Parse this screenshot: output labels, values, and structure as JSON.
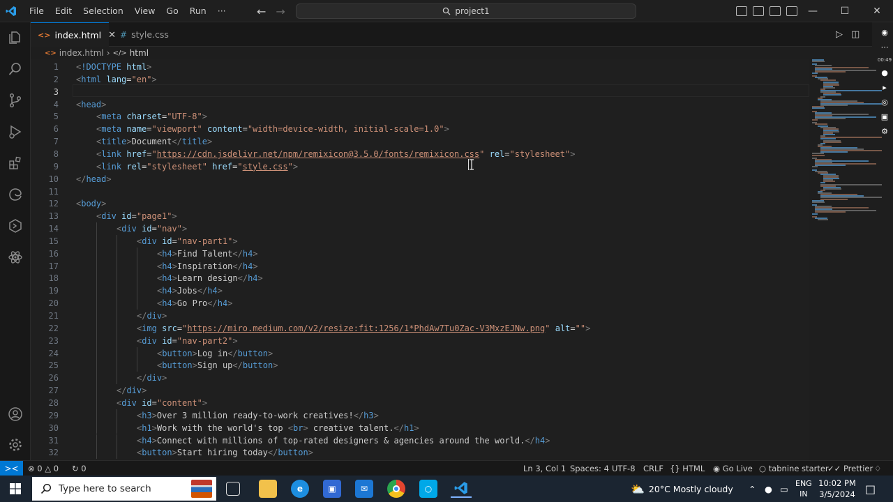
{
  "titlebar": {
    "menu": [
      "File",
      "Edit",
      "Selection",
      "View",
      "Go",
      "Run",
      "···"
    ],
    "search_text": "project1",
    "controls": {
      "minimize": "—",
      "maximize": "☐",
      "close": "✕"
    }
  },
  "activity_bar": {
    "items": [
      "explorer-icon",
      "search-icon",
      "source-control-icon",
      "run-debug-icon",
      "extensions-icon",
      "edge-tools-icon",
      "remote-explorer-icon",
      "ai-assistant-icon"
    ],
    "bottom": [
      "account-icon",
      "settings-gear-icon"
    ]
  },
  "tabs": [
    {
      "label": "index.html",
      "active": true
    },
    {
      "label": "style.css",
      "active": false
    }
  ],
  "breadcrumb": {
    "file": "index.html",
    "sep": "›",
    "symbol": "html"
  },
  "editor": {
    "current_line": 3,
    "lines": [
      {
        "n": "1",
        "indent": 0,
        "parts": [
          [
            "t",
            "<"
          ],
          [
            "tg",
            "!DOCTYPE"
          ],
          [
            "tx",
            " "
          ],
          [
            "at",
            "html"
          ],
          [
            "t",
            ">"
          ]
        ]
      },
      {
        "n": "2",
        "indent": 0,
        "parts": [
          [
            "t",
            "<"
          ],
          [
            "tg",
            "html"
          ],
          [
            "tx",
            " "
          ],
          [
            "at",
            "lang"
          ],
          [
            "tx",
            "="
          ],
          [
            "st",
            "\"en\""
          ],
          [
            "t",
            ">"
          ]
        ]
      },
      {
        "n": "3",
        "indent": 0,
        "parts": []
      },
      {
        "n": "4",
        "indent": 0,
        "parts": [
          [
            "t",
            "<"
          ],
          [
            "tg",
            "head"
          ],
          [
            "t",
            ">"
          ]
        ]
      },
      {
        "n": "5",
        "indent": 1,
        "parts": [
          [
            "t",
            "<"
          ],
          [
            "tg",
            "meta"
          ],
          [
            "tx",
            " "
          ],
          [
            "at",
            "charset"
          ],
          [
            "tx",
            "="
          ],
          [
            "st",
            "\"UTF-8\""
          ],
          [
            "t",
            ">"
          ]
        ]
      },
      {
        "n": "6",
        "indent": 1,
        "parts": [
          [
            "t",
            "<"
          ],
          [
            "tg",
            "meta"
          ],
          [
            "tx",
            " "
          ],
          [
            "at",
            "name"
          ],
          [
            "tx",
            "="
          ],
          [
            "st",
            "\"viewport\""
          ],
          [
            "tx",
            " "
          ],
          [
            "at",
            "content"
          ],
          [
            "tx",
            "="
          ],
          [
            "st",
            "\"width=device-width, initial-scale=1.0\""
          ],
          [
            "t",
            ">"
          ]
        ]
      },
      {
        "n": "7",
        "indent": 1,
        "parts": [
          [
            "t",
            "<"
          ],
          [
            "tg",
            "title"
          ],
          [
            "t",
            ">"
          ],
          [
            "tx",
            "Document"
          ],
          [
            "t",
            "</"
          ],
          [
            "tg",
            "title"
          ],
          [
            "t",
            ">"
          ]
        ]
      },
      {
        "n": "8",
        "indent": 1,
        "parts": [
          [
            "t",
            "<"
          ],
          [
            "tg",
            "link"
          ],
          [
            "tx",
            " "
          ],
          [
            "at",
            "href"
          ],
          [
            "tx",
            "="
          ],
          [
            "st",
            "\""
          ],
          [
            "stu",
            "https://cdn.jsdelivr.net/npm/remixicon@3.5.0/fonts/remixicon.css"
          ],
          [
            "st",
            "\""
          ],
          [
            "tx",
            " "
          ],
          [
            "at",
            "rel"
          ],
          [
            "tx",
            "="
          ],
          [
            "st",
            "\"stylesheet\""
          ],
          [
            "t",
            ">"
          ]
        ]
      },
      {
        "n": "9",
        "indent": 1,
        "parts": [
          [
            "t",
            "<"
          ],
          [
            "tg",
            "link"
          ],
          [
            "tx",
            " "
          ],
          [
            "at",
            "rel"
          ],
          [
            "tx",
            "="
          ],
          [
            "st",
            "\"stylesheet\""
          ],
          [
            "tx",
            " "
          ],
          [
            "at",
            "href"
          ],
          [
            "tx",
            "="
          ],
          [
            "st",
            "\""
          ],
          [
            "stu",
            "style.css"
          ],
          [
            "st",
            "\""
          ],
          [
            "t",
            ">"
          ]
        ]
      },
      {
        "n": "10",
        "indent": 0,
        "parts": [
          [
            "t",
            "</"
          ],
          [
            "tg",
            "head"
          ],
          [
            "t",
            ">"
          ]
        ]
      },
      {
        "n": "11",
        "indent": 0,
        "parts": []
      },
      {
        "n": "12",
        "indent": 0,
        "parts": [
          [
            "t",
            "<"
          ],
          [
            "tg",
            "body"
          ],
          [
            "t",
            ">"
          ]
        ]
      },
      {
        "n": "13",
        "indent": 1,
        "parts": [
          [
            "t",
            "<"
          ],
          [
            "tg",
            "div"
          ],
          [
            "tx",
            " "
          ],
          [
            "at",
            "id"
          ],
          [
            "tx",
            "="
          ],
          [
            "st",
            "\"page1\""
          ],
          [
            "t",
            ">"
          ]
        ]
      },
      {
        "n": "14",
        "indent": 2,
        "parts": [
          [
            "t",
            "<"
          ],
          [
            "tg",
            "div"
          ],
          [
            "tx",
            " "
          ],
          [
            "at",
            "id"
          ],
          [
            "tx",
            "="
          ],
          [
            "st",
            "\"nav\""
          ],
          [
            "t",
            ">"
          ]
        ]
      },
      {
        "n": "15",
        "indent": 3,
        "parts": [
          [
            "t",
            "<"
          ],
          [
            "tg",
            "div"
          ],
          [
            "tx",
            " "
          ],
          [
            "at",
            "id"
          ],
          [
            "tx",
            "="
          ],
          [
            "st",
            "\"nav-part1\""
          ],
          [
            "t",
            ">"
          ]
        ]
      },
      {
        "n": "16",
        "indent": 4,
        "parts": [
          [
            "t",
            "<"
          ],
          [
            "tg",
            "h4"
          ],
          [
            "t",
            ">"
          ],
          [
            "tx",
            "Find Talent"
          ],
          [
            "t",
            "</"
          ],
          [
            "tg",
            "h4"
          ],
          [
            "t",
            ">"
          ]
        ]
      },
      {
        "n": "17",
        "indent": 4,
        "parts": [
          [
            "t",
            "<"
          ],
          [
            "tg",
            "h4"
          ],
          [
            "t",
            ">"
          ],
          [
            "tx",
            "Inspiration"
          ],
          [
            "t",
            "</"
          ],
          [
            "tg",
            "h4"
          ],
          [
            "t",
            ">"
          ]
        ]
      },
      {
        "n": "18",
        "indent": 4,
        "parts": [
          [
            "t",
            "<"
          ],
          [
            "tg",
            "h4"
          ],
          [
            "t",
            ">"
          ],
          [
            "tx",
            "Learn design"
          ],
          [
            "t",
            "</"
          ],
          [
            "tg",
            "h4"
          ],
          [
            "t",
            ">"
          ]
        ]
      },
      {
        "n": "19",
        "indent": 4,
        "parts": [
          [
            "t",
            "<"
          ],
          [
            "tg",
            "h4"
          ],
          [
            "t",
            ">"
          ],
          [
            "tx",
            "Jobs"
          ],
          [
            "t",
            "</"
          ],
          [
            "tg",
            "h4"
          ],
          [
            "t",
            ">"
          ]
        ]
      },
      {
        "n": "20",
        "indent": 4,
        "parts": [
          [
            "t",
            "<"
          ],
          [
            "tg",
            "h4"
          ],
          [
            "t",
            ">"
          ],
          [
            "tx",
            "Go Pro"
          ],
          [
            "t",
            "</"
          ],
          [
            "tg",
            "h4"
          ],
          [
            "t",
            ">"
          ]
        ]
      },
      {
        "n": "21",
        "indent": 3,
        "parts": [
          [
            "t",
            "</"
          ],
          [
            "tg",
            "div"
          ],
          [
            "t",
            ">"
          ]
        ]
      },
      {
        "n": "22",
        "indent": 3,
        "parts": [
          [
            "t",
            "<"
          ],
          [
            "tg",
            "img"
          ],
          [
            "tx",
            " "
          ],
          [
            "at",
            "src"
          ],
          [
            "tx",
            "="
          ],
          [
            "st",
            "\""
          ],
          [
            "stu",
            "https://miro.medium.com/v2/resize:fit:1256/1*PhdAw7Tu0Zac-V3MxzEJNw.png"
          ],
          [
            "st",
            "\""
          ],
          [
            "tx",
            " "
          ],
          [
            "at",
            "alt"
          ],
          [
            "tx",
            "="
          ],
          [
            "st",
            "\"\""
          ],
          [
            "t",
            ">"
          ]
        ]
      },
      {
        "n": "23",
        "indent": 3,
        "parts": [
          [
            "t",
            "<"
          ],
          [
            "tg",
            "div"
          ],
          [
            "tx",
            " "
          ],
          [
            "at",
            "id"
          ],
          [
            "tx",
            "="
          ],
          [
            "st",
            "\"nav-part2\""
          ],
          [
            "t",
            ">"
          ]
        ]
      },
      {
        "n": "24",
        "indent": 4,
        "parts": [
          [
            "t",
            "<"
          ],
          [
            "tg",
            "button"
          ],
          [
            "t",
            ">"
          ],
          [
            "tx",
            "Log in"
          ],
          [
            "t",
            "</"
          ],
          [
            "tg",
            "button"
          ],
          [
            "t",
            ">"
          ]
        ]
      },
      {
        "n": "25",
        "indent": 4,
        "parts": [
          [
            "t",
            "<"
          ],
          [
            "tg",
            "button"
          ],
          [
            "t",
            ">"
          ],
          [
            "tx",
            "Sign up"
          ],
          [
            "t",
            "</"
          ],
          [
            "tg",
            "button"
          ],
          [
            "t",
            ">"
          ]
        ]
      },
      {
        "n": "26",
        "indent": 3,
        "parts": [
          [
            "t",
            "</"
          ],
          [
            "tg",
            "div"
          ],
          [
            "t",
            ">"
          ]
        ]
      },
      {
        "n": "27",
        "indent": 2,
        "parts": [
          [
            "t",
            "</"
          ],
          [
            "tg",
            "div"
          ],
          [
            "t",
            ">"
          ]
        ]
      },
      {
        "n": "28",
        "indent": 2,
        "parts": [
          [
            "t",
            "<"
          ],
          [
            "tg",
            "div"
          ],
          [
            "tx",
            " "
          ],
          [
            "at",
            "id"
          ],
          [
            "tx",
            "="
          ],
          [
            "st",
            "\"content\""
          ],
          [
            "t",
            ">"
          ]
        ]
      },
      {
        "n": "29",
        "indent": 3,
        "parts": [
          [
            "t",
            "<"
          ],
          [
            "tg",
            "h3"
          ],
          [
            "t",
            ">"
          ],
          [
            "tx",
            "Over 3 million ready-to-work creatives!"
          ],
          [
            "t",
            "</"
          ],
          [
            "tg",
            "h3"
          ],
          [
            "t",
            ">"
          ]
        ]
      },
      {
        "n": "30",
        "indent": 3,
        "parts": [
          [
            "t",
            "<"
          ],
          [
            "tg",
            "h1"
          ],
          [
            "t",
            ">"
          ],
          [
            "tx",
            "Work with the world's top "
          ],
          [
            "t",
            "<"
          ],
          [
            "tg",
            "br"
          ],
          [
            "t",
            ">"
          ],
          [
            "tx",
            " creative talent."
          ],
          [
            "t",
            "</"
          ],
          [
            "tg",
            "h1"
          ],
          [
            "t",
            ">"
          ]
        ]
      },
      {
        "n": "31",
        "indent": 3,
        "parts": [
          [
            "t",
            "<"
          ],
          [
            "tg",
            "h4"
          ],
          [
            "t",
            ">"
          ],
          [
            "tx",
            "Connect with millions of top-rated designers & agencies around the world."
          ],
          [
            "t",
            "</"
          ],
          [
            "tg",
            "h4"
          ],
          [
            "t",
            ">"
          ]
        ]
      },
      {
        "n": "32",
        "indent": 3,
        "parts": [
          [
            "t",
            "<"
          ],
          [
            "tg",
            "button"
          ],
          [
            "t",
            ">"
          ],
          [
            "tx",
            "Start hiring today"
          ],
          [
            "t",
            "</"
          ],
          [
            "tg",
            "button"
          ],
          [
            "t",
            ">"
          ]
        ]
      }
    ]
  },
  "right_toolbar": {
    "icons": [
      "camera-icon",
      "more-icon",
      "microphone-icon",
      "speaker-icon",
      "webcam-icon",
      "window-icon",
      "gear-icon"
    ],
    "timer": "00:49"
  },
  "statusbar": {
    "errors": "0",
    "warnings": "0",
    "ports": "0",
    "position": "Ln 3, Col 1",
    "spaces": "Spaces: 4",
    "encoding": "UTF-8",
    "eol": "CRLF",
    "language": "HTML",
    "golive": "Go Live",
    "tabnine": "tabnine starter",
    "prettier": "Prettier"
  },
  "taskbar": {
    "search_placeholder": "Type here to search",
    "weather": "20°C  Mostly cloudy",
    "lang_top": "ENG",
    "lang_bottom": "IN",
    "time": "10:02 PM",
    "date": "3/5/2024"
  },
  "colors": {
    "accent": "#0078d4",
    "tag": "#569cd6",
    "attr": "#9cdcfe",
    "string": "#ce9178"
  }
}
